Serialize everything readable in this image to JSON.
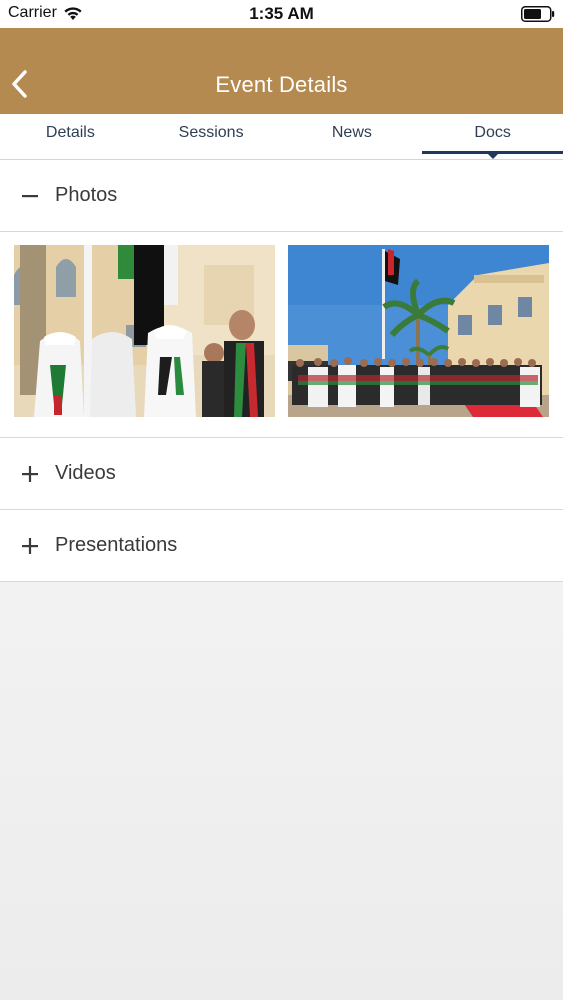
{
  "status_bar": {
    "carrier": "Carrier",
    "time": "1:35 AM"
  },
  "nav": {
    "title": "Event Details",
    "back_icon": "chevron-left-icon"
  },
  "tabs": [
    {
      "label": "Details",
      "active": false
    },
    {
      "label": "Sessions",
      "active": false
    },
    {
      "label": "News",
      "active": false
    },
    {
      "label": "Docs",
      "active": true
    }
  ],
  "sections": [
    {
      "label": "Photos",
      "expanded": true,
      "icon": "minus-icon"
    },
    {
      "label": "Videos",
      "expanded": false,
      "icon": "plus-icon"
    },
    {
      "label": "Presentations",
      "expanded": false,
      "icon": "plus-icon"
    }
  ],
  "colors": {
    "nav_background": "#b48a50",
    "tab_indicator": "#22375c",
    "tab_text": "#2e3e54"
  }
}
